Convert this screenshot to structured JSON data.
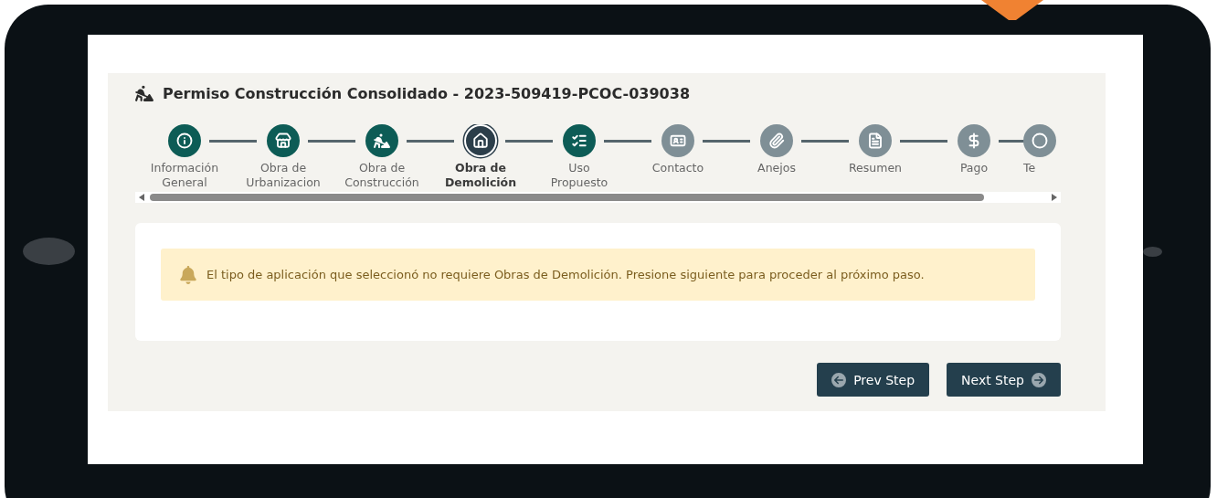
{
  "title": "Permiso Construcción Consolidado - 2023-509419-PCOC-039038",
  "steps": [
    {
      "label": "Información General",
      "completed": true,
      "selected": false
    },
    {
      "label": "Obra de Urbanizacion",
      "completed": true,
      "selected": false
    },
    {
      "label": "Obra de Construcción",
      "completed": true,
      "selected": false
    },
    {
      "label": "Obra de Demolición",
      "completed": false,
      "selected": true
    },
    {
      "label": "Uso Propuesto",
      "completed": true,
      "selected": false
    },
    {
      "label": "Contacto",
      "completed": false,
      "selected": false
    },
    {
      "label": "Anejos",
      "completed": false,
      "selected": false
    },
    {
      "label": "Resumen",
      "completed": false,
      "selected": false
    },
    {
      "label": "Pago",
      "completed": false,
      "selected": false
    },
    {
      "label": "Te",
      "completed": false,
      "selected": false
    }
  ],
  "alert": {
    "message": "El tipo de aplicación que seleccionó no requiere Obras de Demolición. Presione siguiente para proceder al próximo paso."
  },
  "buttons": [
    {
      "label": "Prev Step",
      "kind": "prev"
    },
    {
      "label": "Next Step",
      "kind": "next"
    }
  ]
}
